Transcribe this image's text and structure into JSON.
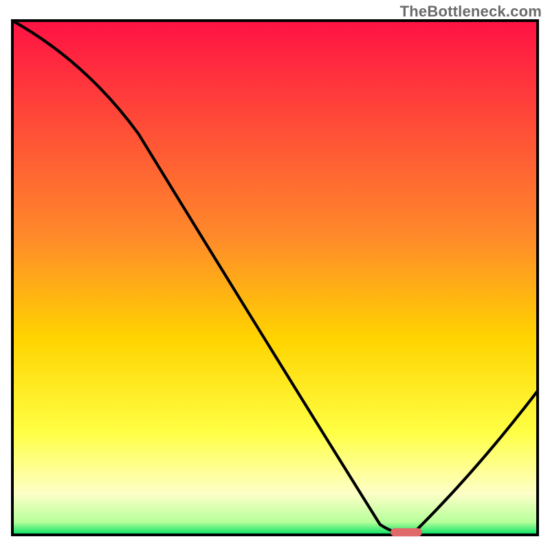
{
  "watermark": "TheBottleneck.com",
  "colors": {
    "gradient_top": "#ff1244",
    "gradient_upper": "#ff6a2a",
    "gradient_mid": "#ffd400",
    "gradient_lower_yellow": "#ffff66",
    "gradient_pale": "#fdffc7",
    "gradient_green": "#00e060",
    "curve": "#000000",
    "marker": "#e06a6a",
    "frame": "#000000"
  },
  "chart_data": {
    "type": "line",
    "title": "",
    "xlabel": "",
    "ylabel": "",
    "xlim": [
      0,
      100
    ],
    "ylim": [
      0,
      100
    ],
    "x": [
      0,
      24,
      70,
      76,
      100
    ],
    "values": [
      100,
      78,
      2,
      0,
      28
    ],
    "marker": {
      "x_start": 72,
      "x_end": 78,
      "y": 0.5
    },
    "gradient_stops": [
      {
        "pos": 0.0,
        "color": "#ff1244"
      },
      {
        "pos": 0.42,
        "color": "#ff8a2a"
      },
      {
        "pos": 0.62,
        "color": "#ffd400"
      },
      {
        "pos": 0.8,
        "color": "#ffff44"
      },
      {
        "pos": 0.92,
        "color": "#fdffc7"
      },
      {
        "pos": 0.975,
        "color": "#b6ff9a"
      },
      {
        "pos": 1.0,
        "color": "#00e060"
      }
    ]
  }
}
